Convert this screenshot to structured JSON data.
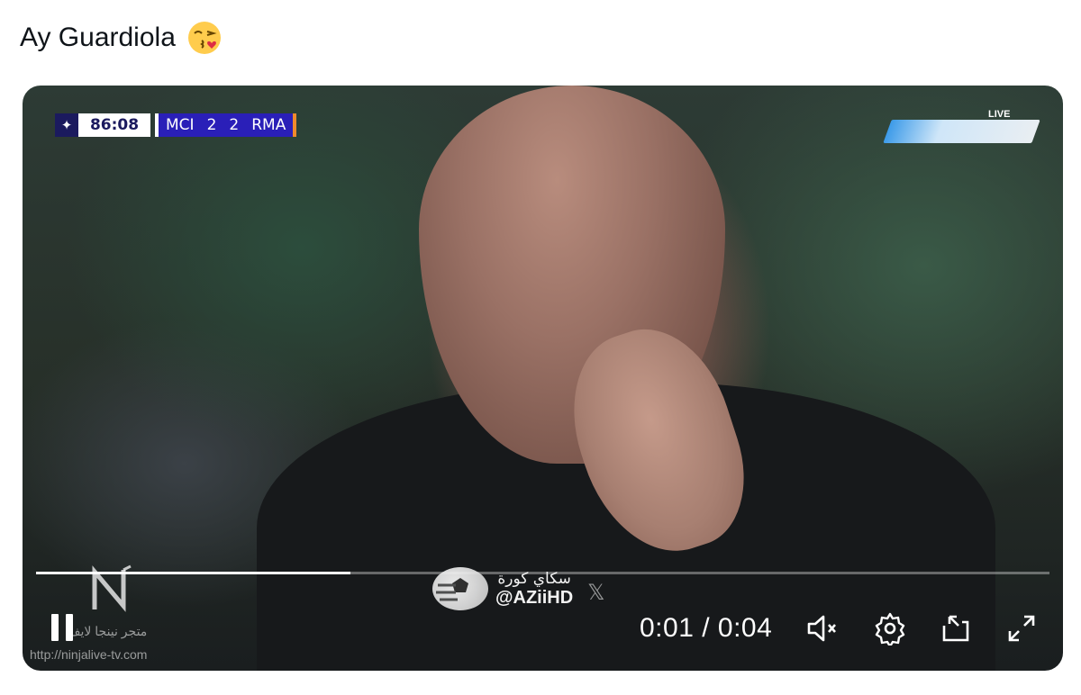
{
  "tweet": {
    "text": "Ay Guardiola",
    "emoji": "face-blowing-kiss-emoji"
  },
  "video": {
    "scorebug": {
      "clock": "86:08",
      "home_team": "MCI",
      "home_score": "2",
      "away_score": "2",
      "away_team": "RMA"
    },
    "live_label": "LIVE",
    "watermarks": {
      "arabic_channel": "سكاي كورة",
      "handle": "@AZiiHD",
      "store_text": "متجر نينجا لايف",
      "url": "http://ninjalive-tv.com"
    },
    "progress": 0.31,
    "time_display": "0:01 / 0:04",
    "controls": [
      "pause-icon",
      "mute-icon",
      "settings-gear-icon",
      "pip-icon",
      "fullscreen-icon"
    ]
  }
}
